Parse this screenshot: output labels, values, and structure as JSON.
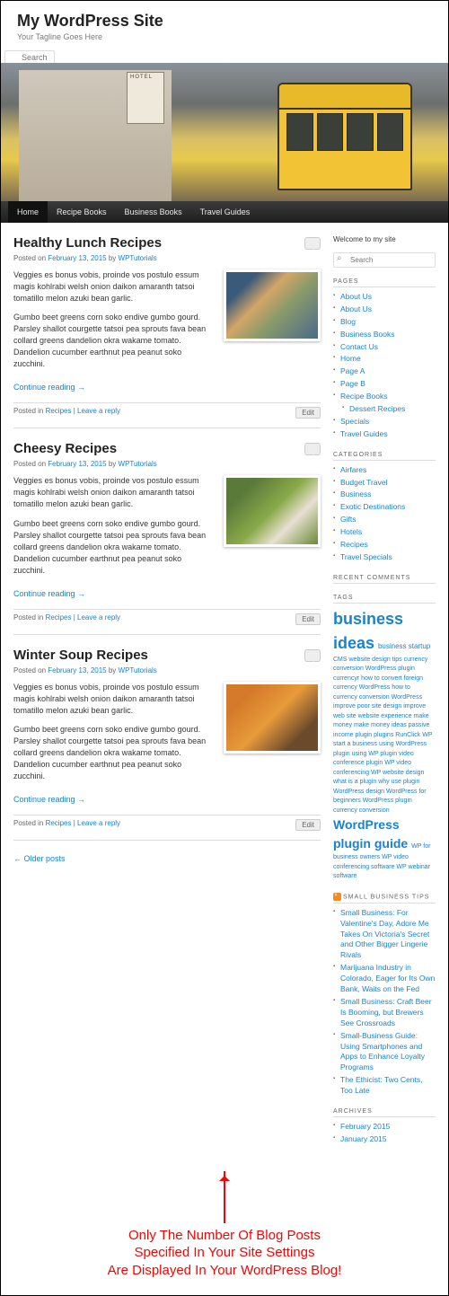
{
  "header": {
    "site_title": "My WordPress Site",
    "tagline": "Your Tagline Goes Here",
    "search_placeholder": "Search"
  },
  "nav": {
    "items": [
      "Home",
      "Recipe Books",
      "Business Books",
      "Travel Guides"
    ]
  },
  "posts": [
    {
      "title": "Healthy Lunch Recipes",
      "date": "February 13, 2015",
      "author": "WPTutorials",
      "posted_on": "Posted on ",
      "by": " by ",
      "para1": "Veggies es bonus vobis, proinde vos postulo essum magis kohlrabi welsh onion daikon amaranth tatsoi tomatillo melon azuki bean garlic.",
      "para2": "Gumbo beet greens corn soko endive gumbo gourd. Parsley shallot courgette tatsoi pea sprouts fava bean collard greens dandelion okra wakame tomato. Dandelion cucumber earthnut pea peanut soko zucchini.",
      "continue": "Continue reading →",
      "posted_in": "Posted in ",
      "category": "Recipes",
      "sep": " | ",
      "leave_reply": "Leave a reply",
      "edit": "Edit"
    },
    {
      "title": "Cheesy Recipes",
      "date": "February 13, 2015",
      "author": "WPTutorials",
      "posted_on": "Posted on ",
      "by": " by ",
      "para1": "Veggies es bonus vobis, proinde vos postulo essum magis kohlrabi welsh onion daikon amaranth tatsoi tomatillo melon azuki bean garlic.",
      "para2": "Gumbo beet greens corn soko endive gumbo gourd. Parsley shallot courgette tatsoi pea sprouts fava bean collard greens dandelion okra wakame tomato. Dandelion cucumber earthnut pea peanut soko zucchini.",
      "continue": "Continue reading →",
      "posted_in": "Posted in ",
      "category": "Recipes",
      "sep": " | ",
      "leave_reply": "Leave a reply",
      "edit": "Edit"
    },
    {
      "title": "Winter Soup Recipes",
      "date": "February 13, 2015",
      "author": "WPTutorials",
      "posted_on": "Posted on ",
      "by": " by ",
      "para1": "Veggies es bonus vobis, proinde vos postulo essum magis kohlrabi welsh onion daikon amaranth tatsoi tomatillo melon azuki bean garlic.",
      "para2": "Gumbo beet greens corn soko endive gumbo gourd. Parsley shallot courgette tatsoi pea sprouts fava bean collard greens dandelion okra wakame tomato. Dandelion cucumber earthnut pea peanut soko zucchini.",
      "continue": "Continue reading →",
      "posted_in": "Posted in ",
      "category": "Recipes",
      "sep": " | ",
      "leave_reply": "Leave a reply",
      "edit": "Edit"
    }
  ],
  "older_posts": "← Older posts",
  "sidebar": {
    "welcome": "Welcome to my site",
    "search_placeholder": "Search",
    "pages_title": "PAGES",
    "pages": [
      "About Us",
      "About Us",
      "Blog",
      "Business Books",
      "Contact Us",
      "Home",
      "Page A",
      "Page B",
      "Recipe Books"
    ],
    "pages_sub": "Dessert Recipes",
    "pages_tail": [
      "Specials",
      "Travel Guides"
    ],
    "categories_title": "CATEGORIES",
    "categories": [
      "Airfares",
      "Budget Travel",
      "Business",
      "Exotic Destinations",
      "Gifts",
      "Hotels",
      "Recipes",
      "Travel Specials"
    ],
    "recent_title": "RECENT COMMENTS",
    "tags_title": "TAGS",
    "tags_big1": "business ideas",
    "tags_med1": "business startup",
    "tags_small": "CMS website design tips currency conversion WordPress plugin currencyr how to convert foreign currency WordPress how to currency conversion WordPress improve poor site design improve web site website experience make money make money ideas passive income plugin plugins RunClick WP start a business using WordPress plugin using WP plugin video conference plugin WP video conferencing WP website design what is a plugin why use plugin WordPress design WordPress for beginners WordPress plugin currency conversion",
    "tags_big2": "WordPress plugin guide",
    "tags_small2": "WP for business owners WP video conferencing software WP webinar software",
    "rss_title": "SMALL BUSINESS TIPS",
    "rss_items": [
      "Small Business: For Valentine's Day, Adore Me Takes On Victoria's Secret and Other Bigger Lingerie Rivals",
      "Marijuana Industry in Colorado, Eager for Its Own Bank, Waits on the Fed",
      "Small Business: Craft Beer Is Booming, but Brewers See Crossroads",
      "Small-Business Guide: Using Smartphones and Apps to Enhance Loyalty Programs",
      "The Ethicist: Two Cents, Too Late"
    ],
    "archives_title": "ARCHIVES",
    "archives": [
      "February 2015",
      "January 2015"
    ]
  },
  "annotation": {
    "line1": "Only The Number Of Blog Posts",
    "line2": "Specified In Your Site Settings",
    "line3": "Are Displayed In Your WordPress Blog!"
  }
}
